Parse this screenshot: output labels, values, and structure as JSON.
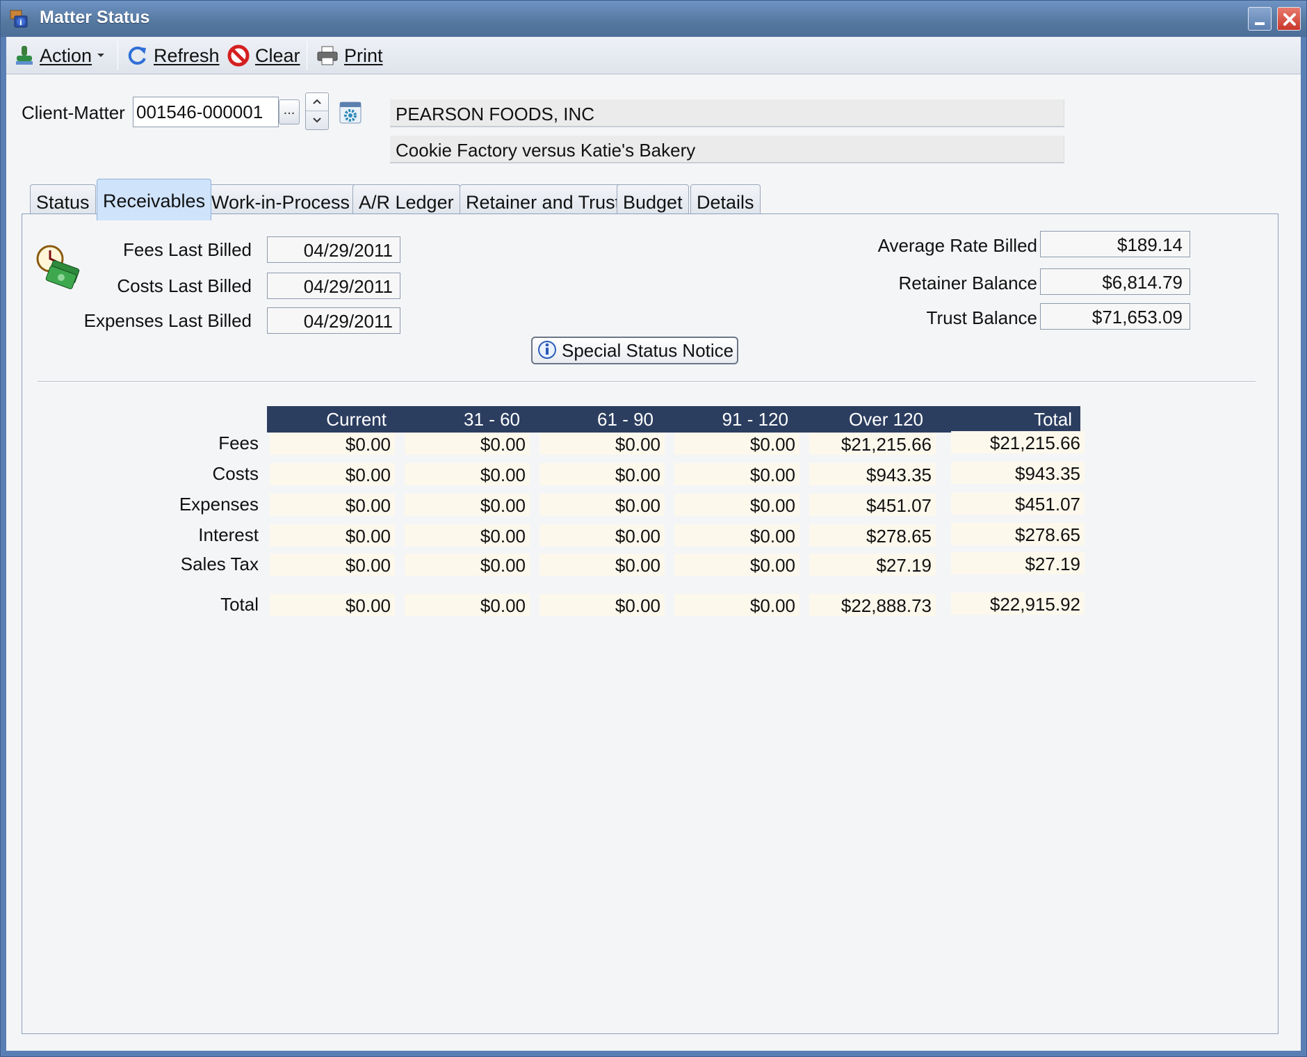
{
  "window": {
    "title": "Matter Status"
  },
  "toolbar": {
    "action_label": "Action",
    "refresh_label": "Refresh",
    "clear_label": "Clear",
    "print_label": "Print"
  },
  "client_matter": {
    "label": "Client-Matter",
    "value": "001546-000001",
    "ellipsis": "...",
    "client_name": "PEARSON FOODS, INC",
    "matter_description": "Cookie Factory versus Katie's Bakery"
  },
  "tabs": [
    {
      "label": "Status"
    },
    {
      "label": "Receivables",
      "active": true
    },
    {
      "label": "Work-in-Process"
    },
    {
      "label": "A/R Ledger"
    },
    {
      "label": "Retainer and Trust"
    },
    {
      "label": "Budget"
    },
    {
      "label": "Details"
    }
  ],
  "receivables": {
    "fees_last_billed_label": "Fees Last Billed",
    "fees_last_billed": "04/29/2011",
    "costs_last_billed_label": "Costs Last Billed",
    "costs_last_billed": "04/29/2011",
    "expenses_last_billed_label": "Expenses Last Billed",
    "expenses_last_billed": "04/29/2011",
    "average_rate_label": "Average Rate Billed",
    "average_rate": "$189.14",
    "retainer_balance_label": "Retainer Balance",
    "retainer_balance": "$6,814.79",
    "trust_balance_label": "Trust Balance",
    "trust_balance": "$71,653.09",
    "special_notice_label": "Special Status Notice"
  },
  "aging": {
    "columns": [
      "Current",
      "31 - 60",
      "61 - 90",
      "91 - 120",
      "Over 120",
      "Total"
    ],
    "rows": [
      {
        "label": "Fees",
        "values": [
          "$0.00",
          "$0.00",
          "$0.00",
          "$0.00",
          "$21,215.66",
          "$21,215.66"
        ]
      },
      {
        "label": "Costs",
        "values": [
          "$0.00",
          "$0.00",
          "$0.00",
          "$0.00",
          "$943.35",
          "$943.35"
        ]
      },
      {
        "label": "Expenses",
        "values": [
          "$0.00",
          "$0.00",
          "$0.00",
          "$0.00",
          "$451.07",
          "$451.07"
        ]
      },
      {
        "label": "Interest",
        "values": [
          "$0.00",
          "$0.00",
          "$0.00",
          "$0.00",
          "$278.65",
          "$278.65"
        ]
      },
      {
        "label": "Sales Tax",
        "values": [
          "$0.00",
          "$0.00",
          "$0.00",
          "$0.00",
          "$27.19",
          "$27.19"
        ]
      },
      {
        "label": "Total",
        "values": [
          "$0.00",
          "$0.00",
          "$0.00",
          "$0.00",
          "$22,888.73",
          "$22,915.92"
        ]
      }
    ]
  },
  "colors": {
    "title_bar": "#55789f",
    "table_header": "#2c3e60",
    "cell_background": "#fdf8ec",
    "active_tab": "#cfe3fb"
  }
}
